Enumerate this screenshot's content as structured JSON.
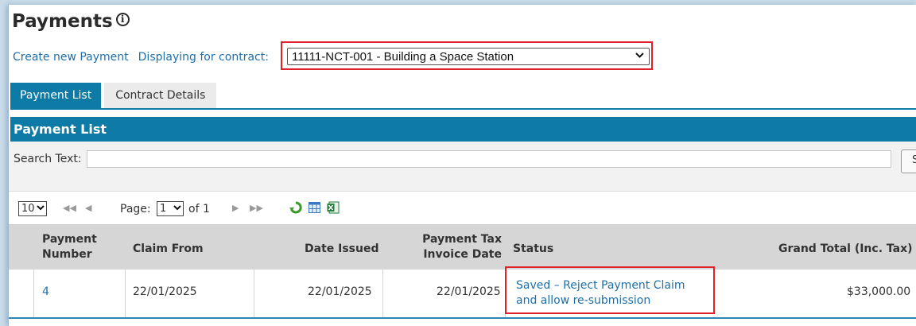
{
  "page": {
    "title": "Payments",
    "info_icon": "i"
  },
  "contract_bar": {
    "create_link": "Create new Payment",
    "displaying_label": "Displaying for contract:",
    "selected_contract": "11111-NCT-001 - Building a Space Station"
  },
  "tabs": [
    {
      "label": "Payment List",
      "active": true
    },
    {
      "label": "Contract Details",
      "active": false
    }
  ],
  "panel": {
    "title": "Payment List"
  },
  "search": {
    "label": "Search Text:",
    "value": "",
    "button_label": "S"
  },
  "pager": {
    "page_size": "10",
    "page_label": "Page:",
    "current_page": "1",
    "of_label": "of 1",
    "icons": [
      "first-page-icon",
      "prev-page-icon",
      "next-page-icon",
      "last-page-icon",
      "refresh-icon",
      "columns-grid-icon",
      "excel-export-icon"
    ]
  },
  "table": {
    "headers": {
      "payment_number": [
        "Payment",
        "Number"
      ],
      "claim_from": "Claim From",
      "date_issued": "Date Issued",
      "tax_invoice_date": [
        "Payment Tax",
        "Invoice Date"
      ],
      "status": "Status",
      "grand_total": "Grand Total (Inc. Tax)"
    },
    "rows": [
      {
        "payment_number": "4",
        "claim_from": "22/01/2025",
        "date_issued": "22/01/2025",
        "tax_invoice_date": "22/01/2025",
        "status": [
          "Saved – Reject Payment Claim",
          "and allow re-submission"
        ],
        "grand_total": "$33,000.00"
      }
    ]
  },
  "colors": {
    "accent": "#0e7aa6",
    "link": "#1f6fa8",
    "highlight": "#e0202a"
  }
}
